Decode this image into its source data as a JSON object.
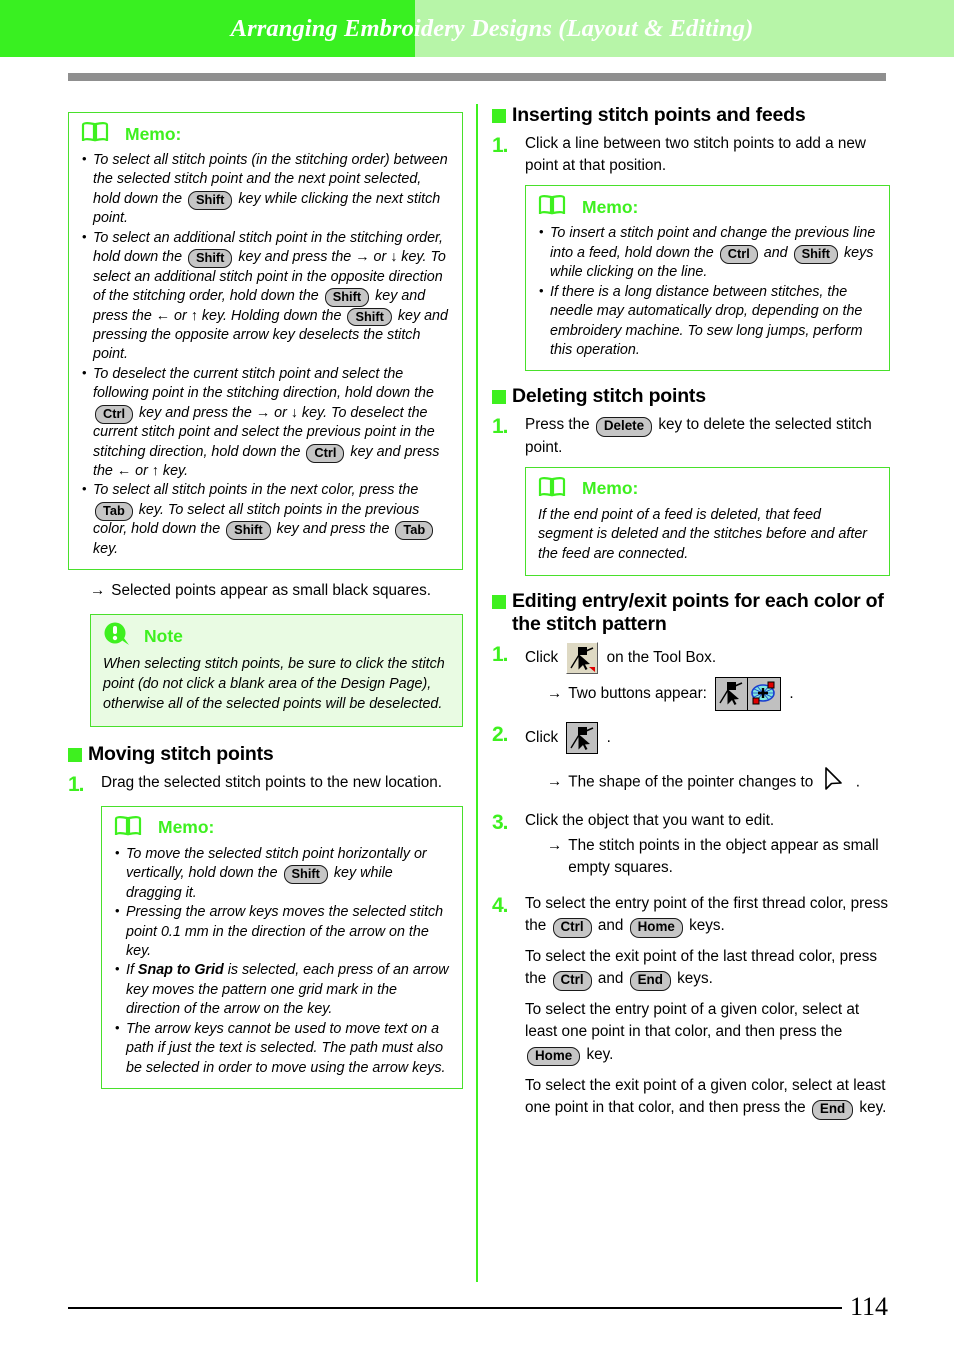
{
  "header": {
    "title": "Arranging Embroidery Designs (Layout & Editing)",
    "band_left_color": "#39f021",
    "band_right_color": "#b7f5a8",
    "rule_color": "#8f8f8f"
  },
  "accent_color": "#3ef01f",
  "memo_label": "Memo:",
  "note_label": "Note",
  "left_column": {
    "memo1": {
      "label": "Memo:",
      "items": [
        {
          "parts": [
            {
              "t": "text",
              "v": "To select all stitch points (in the stitching order) between the selected stitch point and the next point selected, hold down the "
            },
            {
              "t": "key",
              "v": "Shift"
            },
            {
              "t": "text",
              "v": " key while clicking the next stitch point."
            }
          ]
        },
        {
          "parts": [
            {
              "t": "text",
              "v": "To select an additional stitch point in the stitching order, hold down the "
            },
            {
              "t": "key",
              "v": "Shift"
            },
            {
              "t": "text",
              "v": " key and press the → or ↓ key. To select an additional stitch point in the opposite direction of the stitching order, hold down the "
            },
            {
              "t": "key",
              "v": "Shift"
            },
            {
              "t": "text",
              "v": " key and press the ← or ↑ key. Holding down the "
            },
            {
              "t": "key",
              "v": "Shift"
            },
            {
              "t": "text",
              "v": " key and pressing the opposite arrow key deselects the stitch point."
            }
          ]
        },
        {
          "parts": [
            {
              "t": "text",
              "v": "To deselect the current stitch point and select the following point in the stitching direction, hold down the "
            },
            {
              "t": "key",
              "v": "Ctrl"
            },
            {
              "t": "text",
              "v": " key and press the → or ↓ key. To deselect the current stitch point and select the previous point in the stitching direction, hold down the "
            },
            {
              "t": "key",
              "v": "Ctrl"
            },
            {
              "t": "text",
              "v": " key and press the ← or ↑ key."
            }
          ]
        },
        {
          "parts": [
            {
              "t": "text",
              "v": "To select all stitch points in the next color, press the "
            },
            {
              "t": "key",
              "v": "Tab"
            },
            {
              "t": "text",
              "v": " key. To select all stitch points in the previous color, hold down the "
            },
            {
              "t": "key",
              "v": "Shift"
            },
            {
              "t": "text",
              "v": " key and press the "
            },
            {
              "t": "key",
              "v": "Tab"
            },
            {
              "t": "text",
              "v": " key."
            }
          ]
        }
      ]
    },
    "result1": "Selected points appear as small black squares.",
    "note1": {
      "label": "Note",
      "text": "When selecting stitch points, be sure to click the stitch point (do not click a blank area of the Design Page), otherwise all of the selected points will be deselected."
    },
    "section_moving": {
      "heading": "Moving stitch points",
      "step1_num": "1.",
      "step1_text": "Drag the selected stitch points to the new location.",
      "memo": {
        "label": "Memo:",
        "items": [
          {
            "parts": [
              {
                "t": "text",
                "v": "To move the selected stitch point horizontally or vertically, hold down the "
              },
              {
                "t": "key",
                "v": "Shift"
              },
              {
                "t": "text",
                "v": " key while dragging it."
              }
            ]
          },
          {
            "parts": [
              {
                "t": "text",
                "v": "Pressing the arrow keys moves the selected stitch point 0.1 mm in the direction of the arrow on the key."
              }
            ]
          },
          {
            "parts": [
              {
                "t": "text",
                "v": "If "
              },
              {
                "t": "bold",
                "v": "Snap to Grid"
              },
              {
                "t": "text",
                "v": " is selected, each press of an arrow key moves the pattern one grid mark in the direction of the arrow on the key."
              }
            ]
          },
          {
            "parts": [
              {
                "t": "text",
                "v": "The arrow keys cannot be used to move text on a path if just the text is selected. The path must also be selected in order to move using the arrow keys."
              }
            ]
          }
        ]
      }
    }
  },
  "right_column": {
    "section_inserting": {
      "heading": "Inserting stitch points and feeds",
      "step1_num": "1.",
      "step1_text": "Click a line between two stitch points to add a new point at that position.",
      "memo": {
        "label": "Memo:",
        "items": [
          {
            "parts": [
              {
                "t": "text",
                "v": "To insert a stitch point and change the previous line into a feed, hold down the "
              },
              {
                "t": "key",
                "v": "Ctrl"
              },
              {
                "t": "text",
                "v": " and "
              },
              {
                "t": "key",
                "v": "Shift"
              },
              {
                "t": "text",
                "v": " keys while clicking on the line."
              }
            ]
          },
          {
            "parts": [
              {
                "t": "text",
                "v": "If there is a long distance between stitches, the needle may automatically drop, depending on the embroidery machine. To sew long jumps, perform this operation."
              }
            ]
          }
        ]
      }
    },
    "section_deleting": {
      "heading": "Deleting stitch points",
      "step1_num": "1.",
      "step1_parts": [
        {
          "t": "text",
          "v": "Press the "
        },
        {
          "t": "key",
          "v": "Delete"
        },
        {
          "t": "text",
          "v": " key to delete the selected stitch point."
        }
      ],
      "memo": {
        "label": "Memo:",
        "text": "If the end point of a feed is deleted, that feed segment is deleted and the stitches before and after the feed are connected."
      }
    },
    "section_editing": {
      "heading": "Editing entry/exit points for each color of the stitch pattern",
      "step1": {
        "num": "1.",
        "lead": "Click",
        "trail": "on the Tool Box.",
        "icon": "stitch-edit-tool-icon",
        "result_text": "Two buttons appear:",
        "result_icon_a": "stitch-edit-tool-icon",
        "result_icon_b": "stitch-select-tool-icon",
        "result_period": "."
      },
      "step2": {
        "num": "2.",
        "lead": "Click",
        "trail": ".",
        "icon": "stitch-edit-tool-icon",
        "result_text": "The shape of the pointer changes to",
        "result_icon": "pointer-arrow-icon",
        "result_period": "."
      },
      "step3": {
        "num": "3.",
        "text": "Click the object that you want to edit.",
        "result_text": "The stitch points in the object appear as small empty squares."
      },
      "step4": {
        "num": "4.",
        "paragraphs": [
          [
            {
              "t": "text",
              "v": "To select the entry point of the first thread color, press the "
            },
            {
              "t": "key",
              "v": "Ctrl"
            },
            {
              "t": "text",
              "v": " and "
            },
            {
              "t": "key",
              "v": "Home"
            },
            {
              "t": "text",
              "v": " keys."
            }
          ],
          [
            {
              "t": "text",
              "v": "To select the exit point of the last thread color, press the "
            },
            {
              "t": "key",
              "v": "Ctrl"
            },
            {
              "t": "text",
              "v": " and "
            },
            {
              "t": "key",
              "v": "End"
            },
            {
              "t": "text",
              "v": " keys."
            }
          ],
          [
            {
              "t": "text",
              "v": "To select the entry point of a given color, select at least one point in that color, and then press the "
            },
            {
              "t": "key",
              "v": "Home"
            },
            {
              "t": "text",
              "v": " key."
            }
          ],
          [
            {
              "t": "text",
              "v": "To select the exit point of a given color, select at least one point in that color, and then press the "
            },
            {
              "t": "key",
              "v": "End"
            },
            {
              "t": "text",
              "v": " key."
            }
          ]
        ]
      }
    }
  },
  "footer": {
    "page_number": "114"
  }
}
